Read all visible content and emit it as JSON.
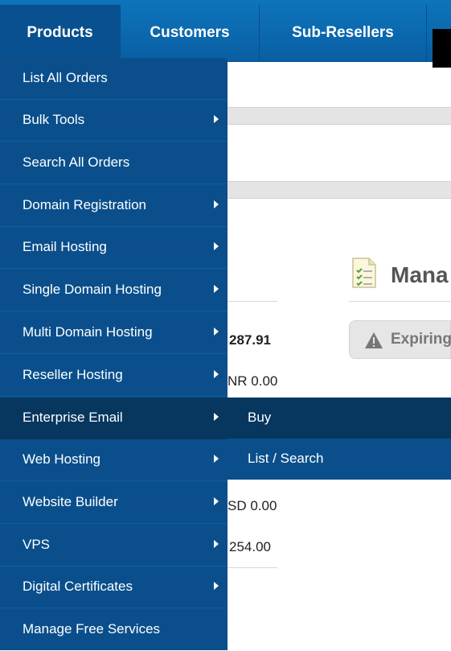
{
  "topnav": {
    "tabs": [
      {
        "label": "Products"
      },
      {
        "label": "Customers"
      },
      {
        "label": "Sub-Resellers"
      }
    ]
  },
  "menu": {
    "items": [
      {
        "label": "List All Orders",
        "has_submenu": false
      },
      {
        "label": "Bulk Tools",
        "has_submenu": true
      },
      {
        "label": "Search All Orders",
        "has_submenu": false
      },
      {
        "label": "Domain Registration",
        "has_submenu": true
      },
      {
        "label": "Email Hosting",
        "has_submenu": true
      },
      {
        "label": "Single Domain Hosting",
        "has_submenu": true
      },
      {
        "label": "Multi Domain Hosting",
        "has_submenu": true
      },
      {
        "label": "Reseller Hosting",
        "has_submenu": true
      },
      {
        "label": "Enterprise Email",
        "has_submenu": true
      },
      {
        "label": "Web Hosting",
        "has_submenu": true
      },
      {
        "label": "Website Builder",
        "has_submenu": true
      },
      {
        "label": "VPS",
        "has_submenu": true
      },
      {
        "label": "Digital Certificates",
        "has_submenu": true
      },
      {
        "label": "Manage Free Services",
        "has_submenu": false
      }
    ]
  },
  "submenu": {
    "items": [
      {
        "label": "Buy"
      },
      {
        "label": "List / Search"
      }
    ]
  },
  "background": {
    "manage_title": "Mana",
    "expiring_tab": "Expiring",
    "values": [
      "287.91",
      "NR 0.00",
      "SD 0.00",
      "254.00"
    ]
  }
}
